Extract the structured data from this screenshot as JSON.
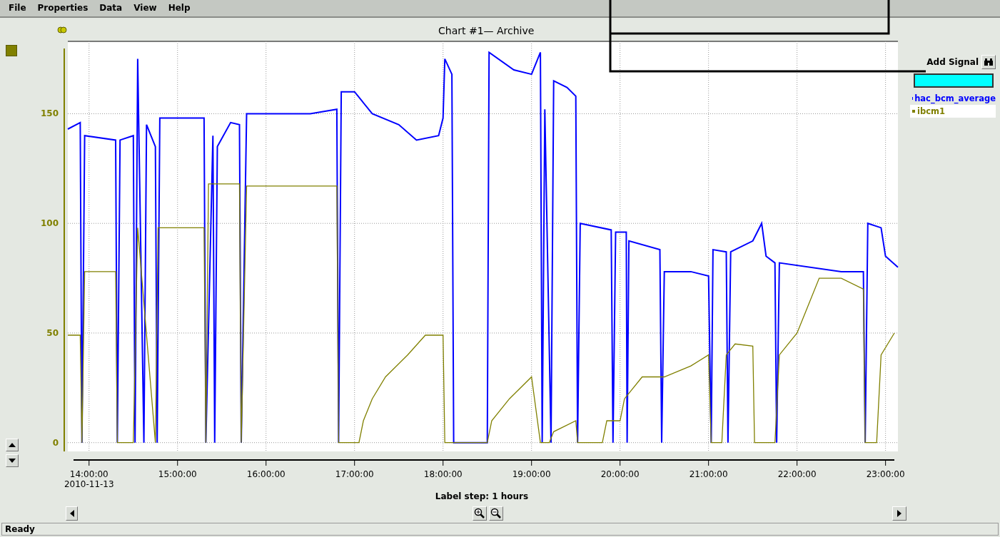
{
  "menu": [
    {
      "label": "File"
    },
    {
      "label": "Properties"
    },
    {
      "label": "Data"
    },
    {
      "label": "View"
    },
    {
      "label": "Help"
    }
  ],
  "chart": {
    "title": "Chart #1— Archive",
    "date_label": "2010-11-13",
    "label_step": "Label step: 1 hours",
    "chart_data": {
      "type": "line",
      "grid": true,
      "xlim": [
        13.76,
        23.14
      ],
      "ylim": [
        -4,
        183
      ],
      "xticks": [
        {
          "value": 14,
          "label": "14:00:00"
        },
        {
          "value": 15,
          "label": "15:00:00"
        },
        {
          "value": 16,
          "label": "16:00:00"
        },
        {
          "value": 17,
          "label": "17:00:00"
        },
        {
          "value": 18,
          "label": "18:00:00"
        },
        {
          "value": 19,
          "label": "19:00:00"
        },
        {
          "value": 20,
          "label": "20:00:00"
        },
        {
          "value": 21,
          "label": "21:00:00"
        },
        {
          "value": 22,
          "label": "22:00:00"
        },
        {
          "value": 23,
          "label": "23:00:00"
        }
      ],
      "yticks": [
        0,
        50,
        100,
        150
      ],
      "series": [
        {
          "name": "hac_bcm_average",
          "color": "#0000ff",
          "x": [
            13.76,
            13.9,
            13.92,
            13.95,
            14.3,
            14.32,
            14.35,
            14.5,
            14.52,
            14.55,
            14.62,
            14.65,
            14.75,
            14.77,
            14.8,
            15.0,
            15.3,
            15.32,
            15.4,
            15.42,
            15.45,
            15.6,
            15.7,
            15.72,
            15.78,
            16.5,
            16.8,
            16.82,
            16.85,
            17.0,
            17.2,
            17.5,
            17.7,
            17.95,
            18.0,
            18.02,
            18.1,
            18.12,
            18.2,
            18.5,
            18.52,
            18.8,
            19.0,
            19.1,
            19.12,
            19.15,
            19.22,
            19.25,
            19.4,
            19.5,
            19.52,
            19.55,
            19.9,
            19.92,
            19.95,
            20.07,
            20.08,
            20.1,
            20.45,
            20.47,
            20.5,
            20.8,
            21.0,
            21.03,
            21.05,
            21.2,
            21.22,
            21.25,
            21.5,
            21.6,
            21.65,
            21.75,
            21.77,
            21.8,
            22.5,
            22.75,
            22.77,
            22.8,
            22.95,
            23.0,
            23.14
          ],
          "values": [
            143,
            146,
            0,
            140,
            138,
            0,
            138,
            140,
            0,
            175,
            0,
            145,
            135,
            0,
            148,
            148,
            148,
            0,
            140,
            0,
            135,
            146,
            145,
            0,
            150,
            150,
            152,
            0,
            160,
            160,
            150,
            145,
            138,
            140,
            148,
            175,
            168,
            0,
            0,
            0,
            178,
            170,
            168,
            178,
            0,
            152,
            0,
            165,
            162,
            158,
            0,
            100,
            97,
            0,
            96,
            96,
            0,
            92,
            88,
            0,
            78,
            78,
            76,
            0,
            88,
            87,
            0,
            87,
            92,
            100,
            85,
            82,
            0,
            82,
            78,
            78,
            0,
            100,
            98,
            85,
            80
          ]
        },
        {
          "name": "ibcm1",
          "color": "#808000",
          "x": [
            13.76,
            13.9,
            13.92,
            13.95,
            14.3,
            14.32,
            14.5,
            14.55,
            14.75,
            14.78,
            15.0,
            15.3,
            15.32,
            15.35,
            15.7,
            15.72,
            15.78,
            16.8,
            16.82,
            17.05,
            17.1,
            17.2,
            17.35,
            17.6,
            17.8,
            18.0,
            18.02,
            18.5,
            18.55,
            18.75,
            19.0,
            19.1,
            19.2,
            19.25,
            19.5,
            19.52,
            19.8,
            19.85,
            20.0,
            20.05,
            20.25,
            20.45,
            20.5,
            20.8,
            21.0,
            21.03,
            21.15,
            21.2,
            21.3,
            21.5,
            21.52,
            21.75,
            21.8,
            22.0,
            22.1,
            22.25,
            22.5,
            22.75,
            22.77,
            22.9,
            22.95,
            23.1
          ],
          "values": [
            49,
            49,
            0,
            78,
            78,
            0,
            0,
            98,
            0,
            98,
            98,
            98,
            0,
            118,
            118,
            0,
            117,
            117,
            0,
            0,
            10,
            20,
            30,
            40,
            49,
            49,
            0,
            0,
            10,
            20,
            30,
            0,
            0,
            5,
            10,
            0,
            0,
            10,
            10,
            20,
            30,
            30,
            30,
            35,
            40,
            0,
            0,
            40,
            45,
            44,
            0,
            0,
            40,
            50,
            60,
            75,
            75,
            70,
            0,
            0,
            40,
            50
          ]
        }
      ]
    }
  },
  "signals": {
    "add_label": "Add Signal",
    "legend": [
      {
        "selected": false
      },
      {
        "selected": true
      }
    ]
  },
  "status_bar": {
    "text": "Ready"
  }
}
